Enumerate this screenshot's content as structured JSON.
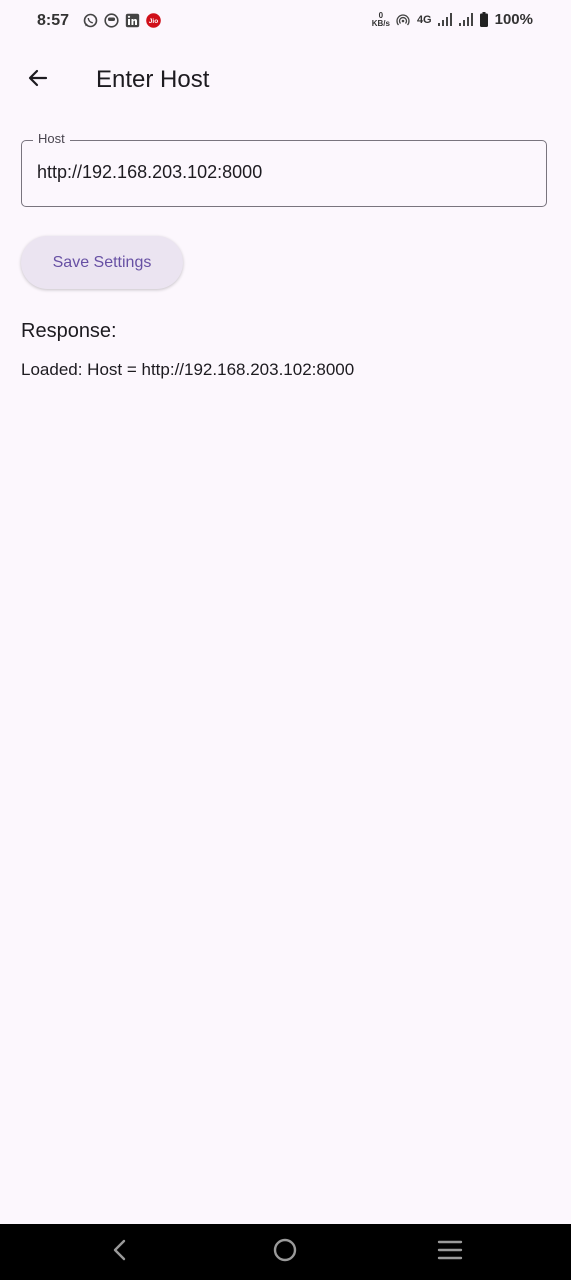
{
  "status_bar": {
    "time": "8:57",
    "notification_icons": [
      "whatsapp-icon",
      "messenger-icon",
      "linkedin-icon",
      "jio-icon"
    ],
    "net_speed_value": "0",
    "net_speed_unit": "KB/s",
    "network_type": "4G",
    "battery": "100%"
  },
  "app_bar": {
    "title": "Enter Host"
  },
  "host_field": {
    "label": "Host",
    "value": "http://192.168.203.102:8000"
  },
  "save_button": {
    "label": "Save Settings"
  },
  "response": {
    "heading": "Response:",
    "text": "Loaded: Host = http://192.168.203.102:8000"
  },
  "colors": {
    "background": "#fcf7fd",
    "primary": "#6750a4",
    "button_bg": "#ebe4f1",
    "outline": "#79747e",
    "nav_bar": "#000000"
  }
}
